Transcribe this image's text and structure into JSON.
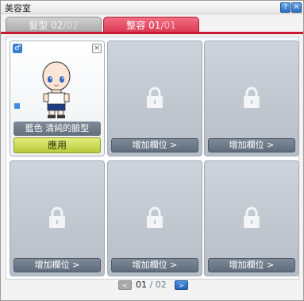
{
  "window": {
    "title": "美容室",
    "help_label": "?",
    "close_label": "×"
  },
  "tabs": [
    {
      "label": "髮型",
      "current": "02",
      "separator": "/",
      "total": "02",
      "active": false
    },
    {
      "label": "整容",
      "current": "01",
      "separator": "/",
      "total": "01",
      "active": true
    }
  ],
  "slots": {
    "active": {
      "gender_icon": "male-icon",
      "gender_glyph": "♂",
      "remove_glyph": "×",
      "face_name": "藍色 清純的臉型",
      "apply_label": "應用"
    },
    "add_slot_label": "增加欄位 >"
  },
  "pager": {
    "prev_glyph": "<",
    "next_glyph": ">",
    "current": "01",
    "separator": "/",
    "total": "02"
  },
  "colors": {
    "accent_tab": "#dc3c57",
    "apply_button": "#c4d64a",
    "locked_slot": "#c1c8d0"
  }
}
